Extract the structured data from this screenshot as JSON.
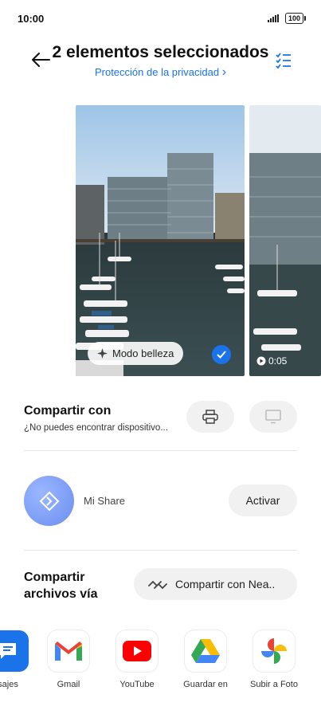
{
  "status": {
    "time": "10:00",
    "battery": "100"
  },
  "header": {
    "title": "2 elementos seleccionados",
    "subtitle": "Protección de la privacidad",
    "subtitle_chevron": "›"
  },
  "photos": {
    "beauty_mode": "Modo belleza",
    "video_duration": "0:05"
  },
  "share_with": {
    "title": "Compartir con",
    "subtitle": "¿No puedes encontrar dispositivo..."
  },
  "mi_share": {
    "label": "Mi Share",
    "button": "Activar"
  },
  "share_via": {
    "title_line1": "Compartir",
    "title_line2": "archivos vía",
    "nearby_button": "Compartir con Nea.."
  },
  "apps": [
    {
      "label": "sajes",
      "icon": "messages-icon"
    },
    {
      "label": "Gmail",
      "icon": "gmail-icon"
    },
    {
      "label": "YouTube",
      "icon": "youtube-icon"
    },
    {
      "label": "Guardar en",
      "icon": "drive-icon"
    },
    {
      "label": "Subir a Foto",
      "icon": "photos-icon"
    }
  ],
  "colors": {
    "accent": "#1a73e8",
    "pill_bg": "#f1f1f1"
  }
}
